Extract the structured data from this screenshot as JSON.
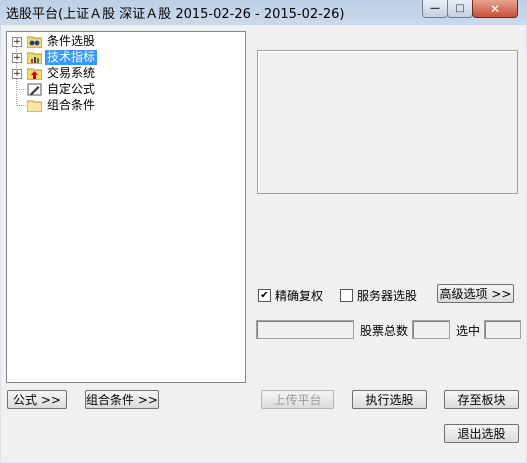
{
  "window": {
    "title": "选股平台(上证Ａ股 深证Ａ股   2015-02-26 - 2015-02-26)",
    "controls": {
      "minimize": "—",
      "maximize": "□",
      "close": "✕"
    }
  },
  "tree": {
    "items": [
      {
        "label": "条件选股",
        "icon": "binoculars-folder-icon",
        "expandable": true
      },
      {
        "label": "技术指标",
        "icon": "chart-folder-icon",
        "expandable": true,
        "selected": true
      },
      {
        "label": "交易系统",
        "icon": "arrow-folder-icon",
        "expandable": true
      },
      {
        "label": "自定公式",
        "icon": "pencil-icon",
        "expandable": false
      },
      {
        "label": "组合条件",
        "icon": "folder-icon",
        "expandable": false
      }
    ]
  },
  "options": {
    "precise_restore": {
      "label": "精确复权",
      "checked": true
    },
    "server_select": {
      "label": "服务器选股",
      "checked": false
    },
    "advanced_button": "高级选项 >>"
  },
  "stats": {
    "total_label": "股票总数",
    "selected_label": "选中",
    "total_value": "",
    "selected_value": "",
    "status_value": ""
  },
  "buttons": {
    "formula": "公式 >>",
    "combo": "组合条件 >>",
    "upload": "上传平台",
    "execute": "执行选股",
    "save_block": "存至板块",
    "exit": "退出选股"
  }
}
